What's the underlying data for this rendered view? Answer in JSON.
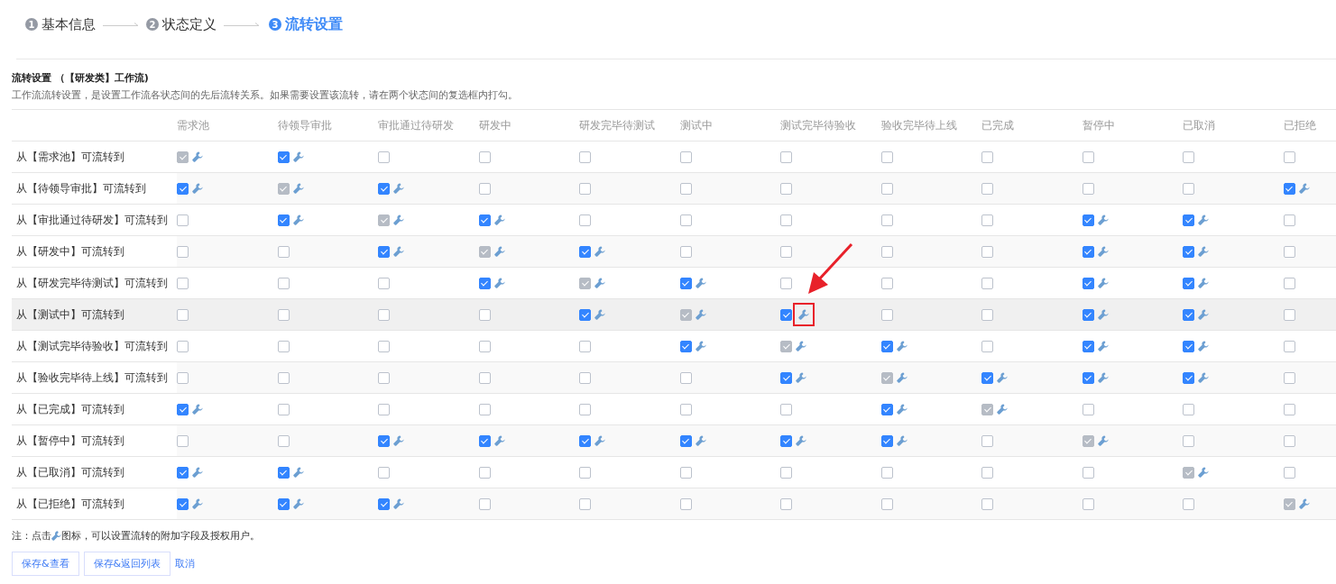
{
  "steps": [
    {
      "number": "1",
      "label": "基本信息",
      "selected": false
    },
    {
      "number": "2",
      "label": "状态定义",
      "selected": false
    },
    {
      "number": "3",
      "label": "流转设置",
      "selected": true
    }
  ],
  "section": {
    "title": "流转设置 （【研发类】工作流)",
    "description": "工作流流转设置，是设置工作流各状态间的先后流转关系。如果需要设置该流转，请在两个状态间的复选框内打勾。"
  },
  "table": {
    "columns": [
      "需求池",
      "待领导审批",
      "审批通过待研发",
      "研发中",
      "研发完毕待测试",
      "测试中",
      "测试完毕待验收",
      "验收完毕待上线",
      "已完成",
      "暂停中",
      "已取消",
      "已拒绝"
    ],
    "rows": [
      {
        "label": "从【需求池】可流转到",
        "highlighted": false,
        "cells": [
          {
            "checked": true,
            "disabled": true
          },
          {
            "checked": true,
            "disabled": false
          },
          {
            "checked": false,
            "disabled": false
          },
          {
            "checked": false,
            "disabled": false
          },
          {
            "checked": false,
            "disabled": false
          },
          {
            "checked": false,
            "disabled": false
          },
          {
            "checked": false,
            "disabled": false
          },
          {
            "checked": false,
            "disabled": false
          },
          {
            "checked": false,
            "disabled": false
          },
          {
            "checked": false,
            "disabled": false
          },
          {
            "checked": false,
            "disabled": false
          },
          {
            "checked": false,
            "disabled": false
          }
        ]
      },
      {
        "label": "从【待领导审批】可流转到",
        "highlighted": false,
        "cells": [
          {
            "checked": true,
            "disabled": false
          },
          {
            "checked": true,
            "disabled": true
          },
          {
            "checked": true,
            "disabled": false
          },
          {
            "checked": false,
            "disabled": false
          },
          {
            "checked": false,
            "disabled": false
          },
          {
            "checked": false,
            "disabled": false
          },
          {
            "checked": false,
            "disabled": false
          },
          {
            "checked": false,
            "disabled": false
          },
          {
            "checked": false,
            "disabled": false
          },
          {
            "checked": false,
            "disabled": false
          },
          {
            "checked": false,
            "disabled": false
          },
          {
            "checked": true,
            "disabled": false
          }
        ]
      },
      {
        "label": "从【审批通过待研发】可流转到",
        "highlighted": false,
        "cells": [
          {
            "checked": false,
            "disabled": false
          },
          {
            "checked": true,
            "disabled": false
          },
          {
            "checked": true,
            "disabled": true
          },
          {
            "checked": true,
            "disabled": false
          },
          {
            "checked": false,
            "disabled": false
          },
          {
            "checked": false,
            "disabled": false
          },
          {
            "checked": false,
            "disabled": false
          },
          {
            "checked": false,
            "disabled": false
          },
          {
            "checked": false,
            "disabled": false
          },
          {
            "checked": true,
            "disabled": false
          },
          {
            "checked": true,
            "disabled": false
          },
          {
            "checked": false,
            "disabled": false
          }
        ]
      },
      {
        "label": "从【研发中】可流转到",
        "highlighted": false,
        "cells": [
          {
            "checked": false,
            "disabled": false
          },
          {
            "checked": false,
            "disabled": false
          },
          {
            "checked": true,
            "disabled": false
          },
          {
            "checked": true,
            "disabled": true
          },
          {
            "checked": true,
            "disabled": false
          },
          {
            "checked": false,
            "disabled": false
          },
          {
            "checked": false,
            "disabled": false
          },
          {
            "checked": false,
            "disabled": false
          },
          {
            "checked": false,
            "disabled": false
          },
          {
            "checked": true,
            "disabled": false
          },
          {
            "checked": true,
            "disabled": false
          },
          {
            "checked": false,
            "disabled": false
          }
        ]
      },
      {
        "label": "从【研发完毕待测试】可流转到",
        "highlighted": false,
        "cells": [
          {
            "checked": false,
            "disabled": false
          },
          {
            "checked": false,
            "disabled": false
          },
          {
            "checked": false,
            "disabled": false
          },
          {
            "checked": true,
            "disabled": false
          },
          {
            "checked": true,
            "disabled": true
          },
          {
            "checked": true,
            "disabled": false
          },
          {
            "checked": false,
            "disabled": false
          },
          {
            "checked": false,
            "disabled": false
          },
          {
            "checked": false,
            "disabled": false
          },
          {
            "checked": true,
            "disabled": false
          },
          {
            "checked": true,
            "disabled": false
          },
          {
            "checked": false,
            "disabled": false
          }
        ]
      },
      {
        "label": "从【测试中】可流转到",
        "highlighted": true,
        "cells": [
          {
            "checked": false,
            "disabled": false
          },
          {
            "checked": false,
            "disabled": false
          },
          {
            "checked": false,
            "disabled": false
          },
          {
            "checked": false,
            "disabled": false
          },
          {
            "checked": true,
            "disabled": false
          },
          {
            "checked": true,
            "disabled": true
          },
          {
            "checked": true,
            "disabled": false,
            "marked": true
          },
          {
            "checked": false,
            "disabled": false
          },
          {
            "checked": false,
            "disabled": false
          },
          {
            "checked": true,
            "disabled": false
          },
          {
            "checked": true,
            "disabled": false
          },
          {
            "checked": false,
            "disabled": false
          }
        ]
      },
      {
        "label": "从【测试完毕待验收】可流转到",
        "highlighted": false,
        "cells": [
          {
            "checked": false,
            "disabled": false
          },
          {
            "checked": false,
            "disabled": false
          },
          {
            "checked": false,
            "disabled": false
          },
          {
            "checked": false,
            "disabled": false
          },
          {
            "checked": false,
            "disabled": false
          },
          {
            "checked": true,
            "disabled": false
          },
          {
            "checked": true,
            "disabled": true
          },
          {
            "checked": true,
            "disabled": false
          },
          {
            "checked": false,
            "disabled": false
          },
          {
            "checked": true,
            "disabled": false
          },
          {
            "checked": true,
            "disabled": false
          },
          {
            "checked": false,
            "disabled": false
          }
        ]
      },
      {
        "label": "从【验收完毕待上线】可流转到",
        "highlighted": false,
        "cells": [
          {
            "checked": false,
            "disabled": false
          },
          {
            "checked": false,
            "disabled": false
          },
          {
            "checked": false,
            "disabled": false
          },
          {
            "checked": false,
            "disabled": false
          },
          {
            "checked": false,
            "disabled": false
          },
          {
            "checked": false,
            "disabled": false
          },
          {
            "checked": true,
            "disabled": false
          },
          {
            "checked": true,
            "disabled": true
          },
          {
            "checked": true,
            "disabled": false
          },
          {
            "checked": true,
            "disabled": false
          },
          {
            "checked": true,
            "disabled": false
          },
          {
            "checked": false,
            "disabled": false
          }
        ]
      },
      {
        "label": "从【已完成】可流转到",
        "highlighted": false,
        "cells": [
          {
            "checked": true,
            "disabled": false
          },
          {
            "checked": false,
            "disabled": false
          },
          {
            "checked": false,
            "disabled": false
          },
          {
            "checked": false,
            "disabled": false
          },
          {
            "checked": false,
            "disabled": false
          },
          {
            "checked": false,
            "disabled": false
          },
          {
            "checked": false,
            "disabled": false
          },
          {
            "checked": true,
            "disabled": false
          },
          {
            "checked": true,
            "disabled": true
          },
          {
            "checked": false,
            "disabled": false
          },
          {
            "checked": false,
            "disabled": false
          },
          {
            "checked": false,
            "disabled": false
          }
        ]
      },
      {
        "label": "从【暂停中】可流转到",
        "highlighted": false,
        "cells": [
          {
            "checked": false,
            "disabled": false
          },
          {
            "checked": false,
            "disabled": false
          },
          {
            "checked": true,
            "disabled": false
          },
          {
            "checked": true,
            "disabled": false
          },
          {
            "checked": true,
            "disabled": false
          },
          {
            "checked": true,
            "disabled": false
          },
          {
            "checked": true,
            "disabled": false
          },
          {
            "checked": true,
            "disabled": false
          },
          {
            "checked": false,
            "disabled": false
          },
          {
            "checked": true,
            "disabled": true
          },
          {
            "checked": false,
            "disabled": false
          },
          {
            "checked": false,
            "disabled": false
          }
        ]
      },
      {
        "label": "从【已取消】可流转到",
        "highlighted": false,
        "cells": [
          {
            "checked": true,
            "disabled": false
          },
          {
            "checked": true,
            "disabled": false
          },
          {
            "checked": false,
            "disabled": false
          },
          {
            "checked": false,
            "disabled": false
          },
          {
            "checked": false,
            "disabled": false
          },
          {
            "checked": false,
            "disabled": false
          },
          {
            "checked": false,
            "disabled": false
          },
          {
            "checked": false,
            "disabled": false
          },
          {
            "checked": false,
            "disabled": false
          },
          {
            "checked": false,
            "disabled": false
          },
          {
            "checked": true,
            "disabled": true
          },
          {
            "checked": false,
            "disabled": false
          }
        ]
      },
      {
        "label": "从【已拒绝】可流转到",
        "highlighted": false,
        "cells": [
          {
            "checked": true,
            "disabled": false
          },
          {
            "checked": true,
            "disabled": false
          },
          {
            "checked": true,
            "disabled": false
          },
          {
            "checked": false,
            "disabled": false
          },
          {
            "checked": false,
            "disabled": false
          },
          {
            "checked": false,
            "disabled": false
          },
          {
            "checked": false,
            "disabled": false
          },
          {
            "checked": false,
            "disabled": false
          },
          {
            "checked": false,
            "disabled": false
          },
          {
            "checked": false,
            "disabled": false
          },
          {
            "checked": false,
            "disabled": false
          },
          {
            "checked": true,
            "disabled": true
          }
        ]
      }
    ]
  },
  "note": {
    "before": "注：点击",
    "after": "图标，可以设置流转的附加字段及授权用户。"
  },
  "buttons": [
    {
      "label": "保存&查看",
      "kind": "button"
    },
    {
      "label": "保存&返回列表",
      "kind": "button"
    },
    {
      "label": "取消",
      "kind": "link"
    }
  ]
}
